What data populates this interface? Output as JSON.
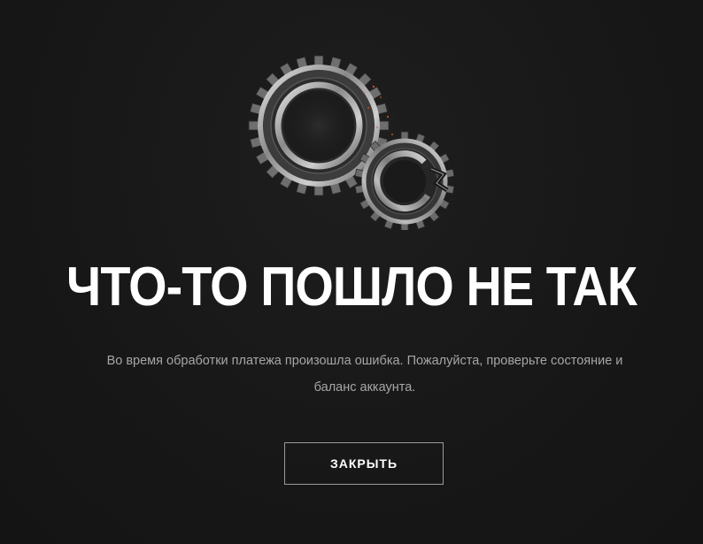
{
  "illustration": {
    "icon": "broken-gears-icon",
    "colors": {
      "metal_light": "#d9d9d9",
      "metal_mid": "#8c8c8c",
      "metal_dark": "#2a2a2a",
      "spark": "#c8501e"
    }
  },
  "error": {
    "title": "ЧТО-ТО ПОШЛО НЕ ТАК",
    "message": "Во время обработки платежа произошла ошибка. Пожалуйста, проверьте состояние и баланс аккаунта."
  },
  "actions": {
    "close_label": "ЗАКРЫТЬ"
  },
  "theme": {
    "background": "#181818",
    "title_color": "#ffffff",
    "message_color": "#a6a6a6",
    "button_border": "#9a9a9a"
  }
}
